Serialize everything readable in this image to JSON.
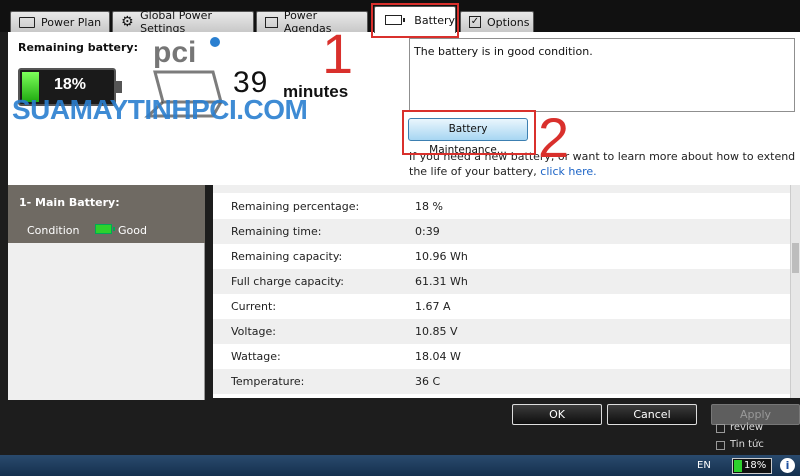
{
  "tabs": [
    {
      "label": "Power Plan"
    },
    {
      "label": "Global Power Settings"
    },
    {
      "label": "Power Agendas"
    },
    {
      "label": "Battery"
    },
    {
      "label": "Options"
    }
  ],
  "battery_panel": {
    "remaining_label": "Remaining battery:",
    "percent_text": "18%",
    "percent_value": 0.18,
    "time_number": "39",
    "time_unit": "minutes",
    "status_message": "The battery is in good condition.",
    "maintenance_button": "Battery Maintenance...",
    "help_text": "If you need a new battery, or want to learn more about how to extend the life of your battery, ",
    "help_link": "click here."
  },
  "watermark": "SUAMAYTINHPCI.COM",
  "annotations": [
    "1",
    "2"
  ],
  "sidebar": {
    "title": "1- Main Battery:",
    "condition_label": "Condition",
    "condition_value": "Good"
  },
  "details": [
    {
      "label": "Remaining percentage:",
      "value": "18 %"
    },
    {
      "label": "Remaining time:",
      "value": "0:39"
    },
    {
      "label": "Remaining capacity:",
      "value": "10.96 Wh"
    },
    {
      "label": "Full charge capacity:",
      "value": "61.31 Wh"
    },
    {
      "label": "Current:",
      "value": "1.67 A"
    },
    {
      "label": "Voltage:",
      "value": "10.85 V"
    },
    {
      "label": "Wattage:",
      "value": "18.04 W"
    },
    {
      "label": "Temperature:",
      "value": "36 C"
    }
  ],
  "buttons": {
    "ok": "OK",
    "cancel": "Cancel",
    "apply": "Apply"
  },
  "background_items": [
    "review",
    "Tin tức"
  ],
  "taskbar": {
    "language": "EN",
    "battery_text": "18%"
  },
  "colors": {
    "accent_red": "#d9302c",
    "battery_green": "#2dd12d",
    "link_blue": "#1b63c6",
    "watermark_blue": "#2a7fd0"
  }
}
